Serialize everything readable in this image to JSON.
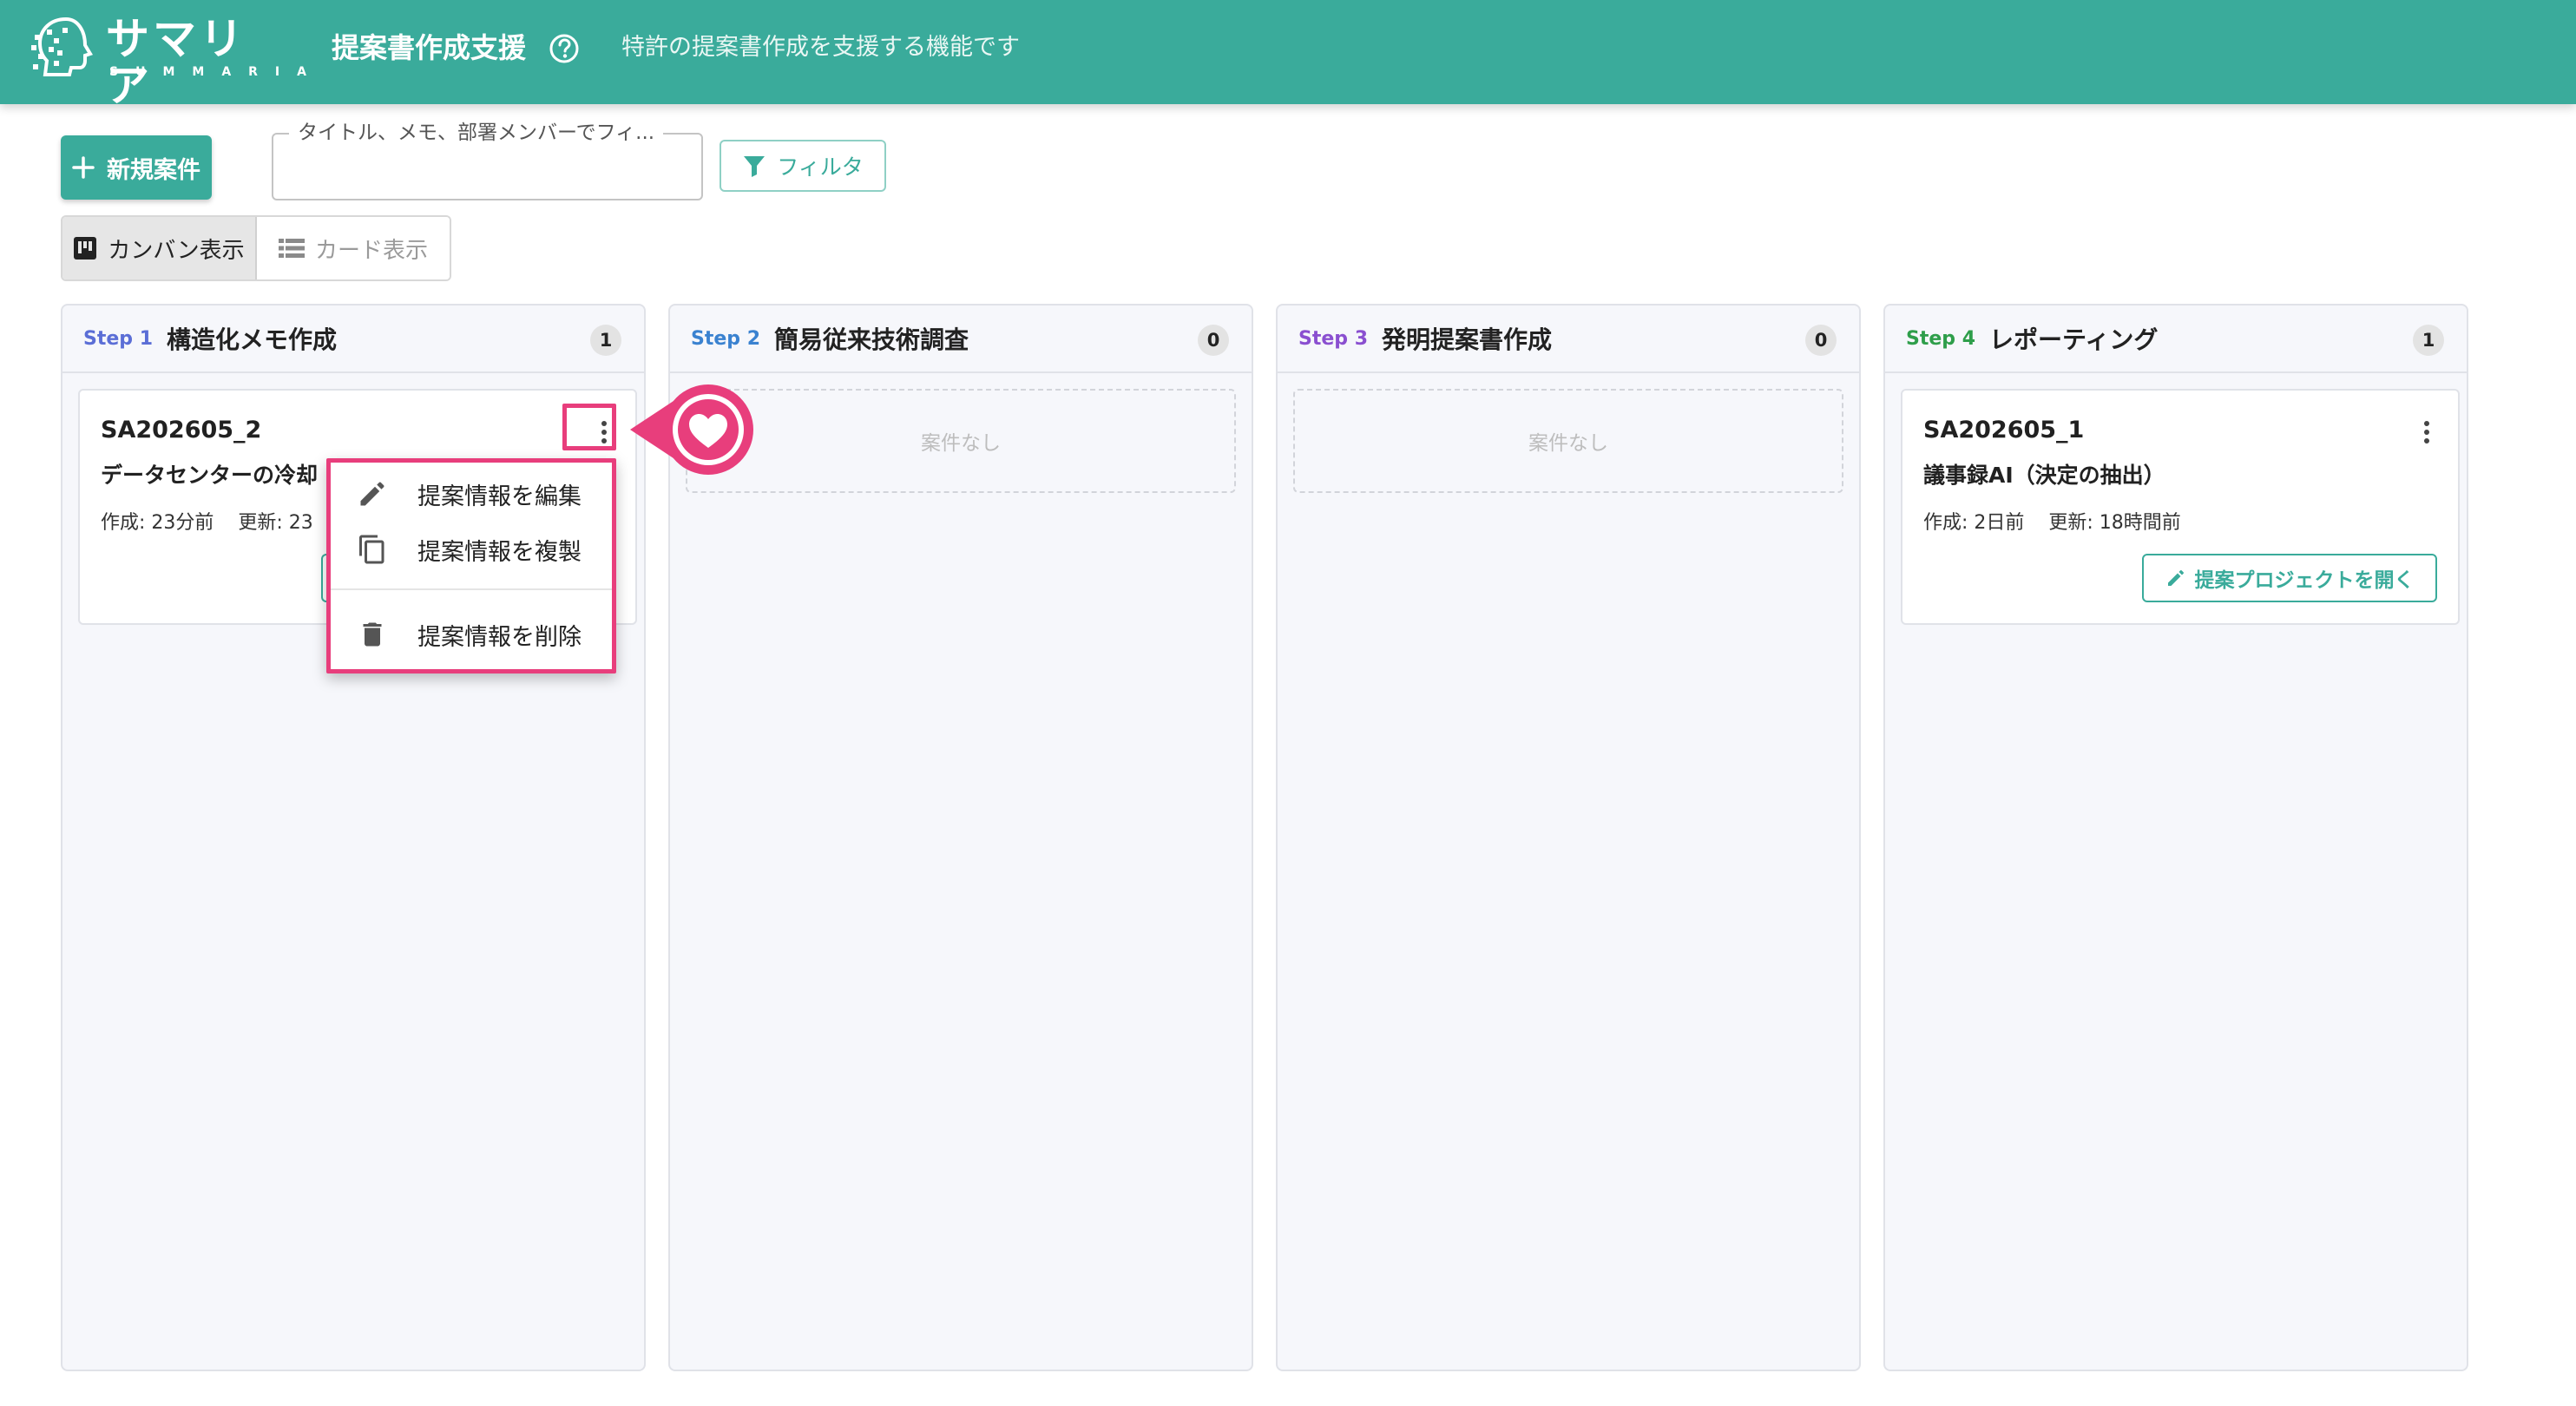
{
  "header": {
    "logo_jp": "サマリア",
    "logo_en": "SUMMARIA",
    "title": "提案書作成支援",
    "description": "特許の提案書作成を支援する機能です"
  },
  "toolbar": {
    "new_button": "新規案件",
    "search_label": "タイトル、メモ、部署メンバーでフィ...",
    "search_value": "",
    "filter_button": "フィルタ",
    "view_kanban": "カンバン表示",
    "view_card": "カード表示"
  },
  "colors": {
    "brand": "#3aab9b",
    "highlight": "#e83e7c",
    "step1": "#5b6ed6",
    "step2": "#3a82d0",
    "step3": "#8a4fd0",
    "step4": "#2e9e4a"
  },
  "columns": [
    {
      "step": "Step 1",
      "title": "構造化メモ作成",
      "count": "1",
      "cards": [
        {
          "id": "SA202605_2",
          "title": "データセンターの冷却",
          "created": "作成: 23分前",
          "updated": "更新: 23"
        }
      ]
    },
    {
      "step": "Step 2",
      "title": "簡易従来技術調査",
      "count": "0",
      "empty_text": "案件なし"
    },
    {
      "step": "Step 3",
      "title": "発明提案書作成",
      "count": "0",
      "empty_text": "案件なし"
    },
    {
      "step": "Step 4",
      "title": "レポーティング",
      "count": "1",
      "cards": [
        {
          "id": "SA202605_1",
          "title": "議事録AI（決定の抽出）",
          "created": "作成: 2日前",
          "updated": "更新: 18時間前",
          "open_button": "提案プロジェクトを開く"
        }
      ]
    }
  ],
  "context_menu": {
    "edit": "提案情報を編集",
    "duplicate": "提案情報を複製",
    "delete": "提案情報を削除"
  },
  "icons": {
    "help": "help-circle-icon",
    "plus": "plus-icon",
    "filter": "filter-icon",
    "kanban": "kanban-icon",
    "list": "list-icon",
    "kebab": "more-vertical-icon",
    "edit": "pencil-icon",
    "copy": "copy-icon",
    "trash": "trash-icon",
    "heart": "heart-icon"
  }
}
